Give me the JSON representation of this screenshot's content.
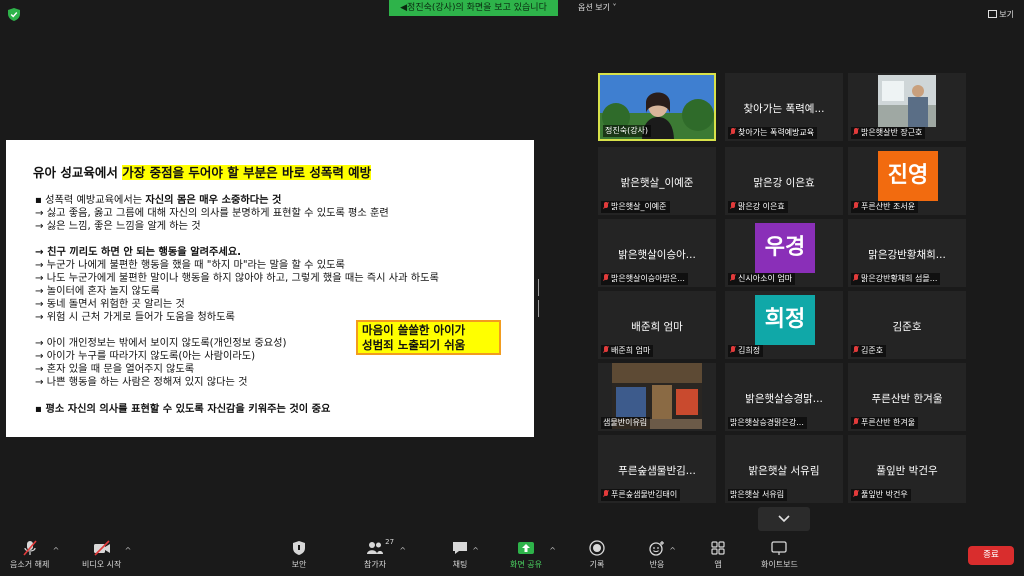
{
  "top": {
    "share_banner": "정진숙(강사)의 화면을 보고 있습니다",
    "options_label": "옵션 보기",
    "view_label": "보기"
  },
  "slide": {
    "title_prefix": "유아 성교육에서 ",
    "title_highlight": "가장 중점을 두어야 할 부분은 바로 성폭력 예방",
    "lines": [
      {
        "text": "▪  성폭력 예방교육에서는 ",
        "bold": "자신의 몸은 매우 소중하다는 것"
      },
      {
        "text": "→ 싫고 좋음, 옳고 그름에 대해 자신의 의사를 분명하게 표현할 수 있도록 평소 훈련"
      },
      {
        "text": "→ 싫은 느낌, 좋은 느낌을 알게 하는 것"
      },
      {
        "text": "→ 친구 끼리도 하면 안 되는 행동을 알려주세요.",
        "is_bold": true
      },
      {
        "text": "→ 누군가 나에게 불편한 행동을 했을 때 \"하지 마\"라는 말을 할 수 있도록"
      },
      {
        "text": "→ 나도 누군가에게 불편한 말이나 행동을 하지 않아야 하고, 그렇게 했을 때는 즉시 사과 하도록"
      },
      {
        "text": "→ 놀이터에 혼자 놀지 않도록"
      },
      {
        "text": "→ 동네 돌면서 위험한 곳 알리는 것"
      },
      {
        "text": "→ 위험 시 근처 가게로 들어가 도움을 청하도록"
      },
      {
        "text": "→ 아이 개인정보는 밖에서 보이지 않도록(개인정보 중요성)"
      },
      {
        "text": "→ 아이가 누구를 따라가지 않도록(아는 사람이라도)"
      },
      {
        "text": "→ 혼자 있을 때 문을 열어주지 않도록"
      },
      {
        "text": "→ 나쁜 행동을 하는 사람은 정해져 있지 않다는 것"
      },
      {
        "text": "▪  평소 자신의 의사를 표현할 수 있도록 자신감을 키워주는 것이 중요",
        "is_bold": true
      }
    ],
    "callout_line1": "마음이 쓸쓸한 아이가",
    "callout_line2": "성범죄 노출되기 쉬움"
  },
  "participants": [
    {
      "center": "",
      "label": "정진숙(강사)",
      "type": "video-instructor",
      "active": true
    },
    {
      "center": "찾아가는 폭력예...",
      "label": "찾아가는 폭력예방교육",
      "type": "name"
    },
    {
      "center": "",
      "label": "밝은햇살반 장근호",
      "type": "video-room"
    },
    {
      "center": "밝은햇살_이예준",
      "label": "밝은햇살_이예준",
      "type": "name"
    },
    {
      "center": "맑은강 이은효",
      "label": "맑은강 이은효",
      "type": "name"
    },
    {
      "center": "진영",
      "label": "푸른산반 조서윤",
      "type": "avatar",
      "color": "#f26b0f"
    },
    {
      "center": "밝은햇살이승아...",
      "label": "밝은햇살이승아밝은...",
      "type": "name"
    },
    {
      "center": "우경",
      "label": "신시아소이 엄마",
      "type": "avatar",
      "color": "#8a2fb8"
    },
    {
      "center": "맑은강반황채희...",
      "label": "맑은강반황채희 섬몰...",
      "type": "name"
    },
    {
      "center": "배준희 엄마",
      "label": "배준희 엄마",
      "type": "name"
    },
    {
      "center": "희정",
      "label": "김희정",
      "type": "avatar",
      "color": "#10a8a8"
    },
    {
      "center": "김준호",
      "label": "김준호",
      "type": "name"
    },
    {
      "center": "",
      "label": "샘물반이유림",
      "type": "video-store"
    },
    {
      "center": "밝은햇살승경맑...",
      "label": "밝은햇살승경맑은강...",
      "type": "name"
    },
    {
      "center": "푸른산반 한겨울",
      "label": "푸른산반 한겨울",
      "type": "name"
    },
    {
      "center": "푸른숲샘물반김...",
      "label": "푸른숲샘물반김태이",
      "type": "name"
    },
    {
      "center": "밝은햇살 서유림",
      "label": "밝은햇살 서유림",
      "type": "name"
    },
    {
      "center": "풀잎반 박건우",
      "label": "풀잎반 박건우",
      "type": "name"
    }
  ],
  "toolbar": {
    "mute": "음소거 해제",
    "video": "비디오 시작",
    "security": "보안",
    "participants": "참가자",
    "participants_count": "27",
    "chat": "채팅",
    "share": "화면 공유",
    "record": "기록",
    "reactions": "반응",
    "apps": "앱",
    "whiteboard": "화이트보드",
    "end": "종료"
  },
  "colors": {
    "banner": "#2eb34a",
    "highlight": "#ffff00",
    "end": "#d92d2d",
    "share_green": "#4cd964"
  }
}
